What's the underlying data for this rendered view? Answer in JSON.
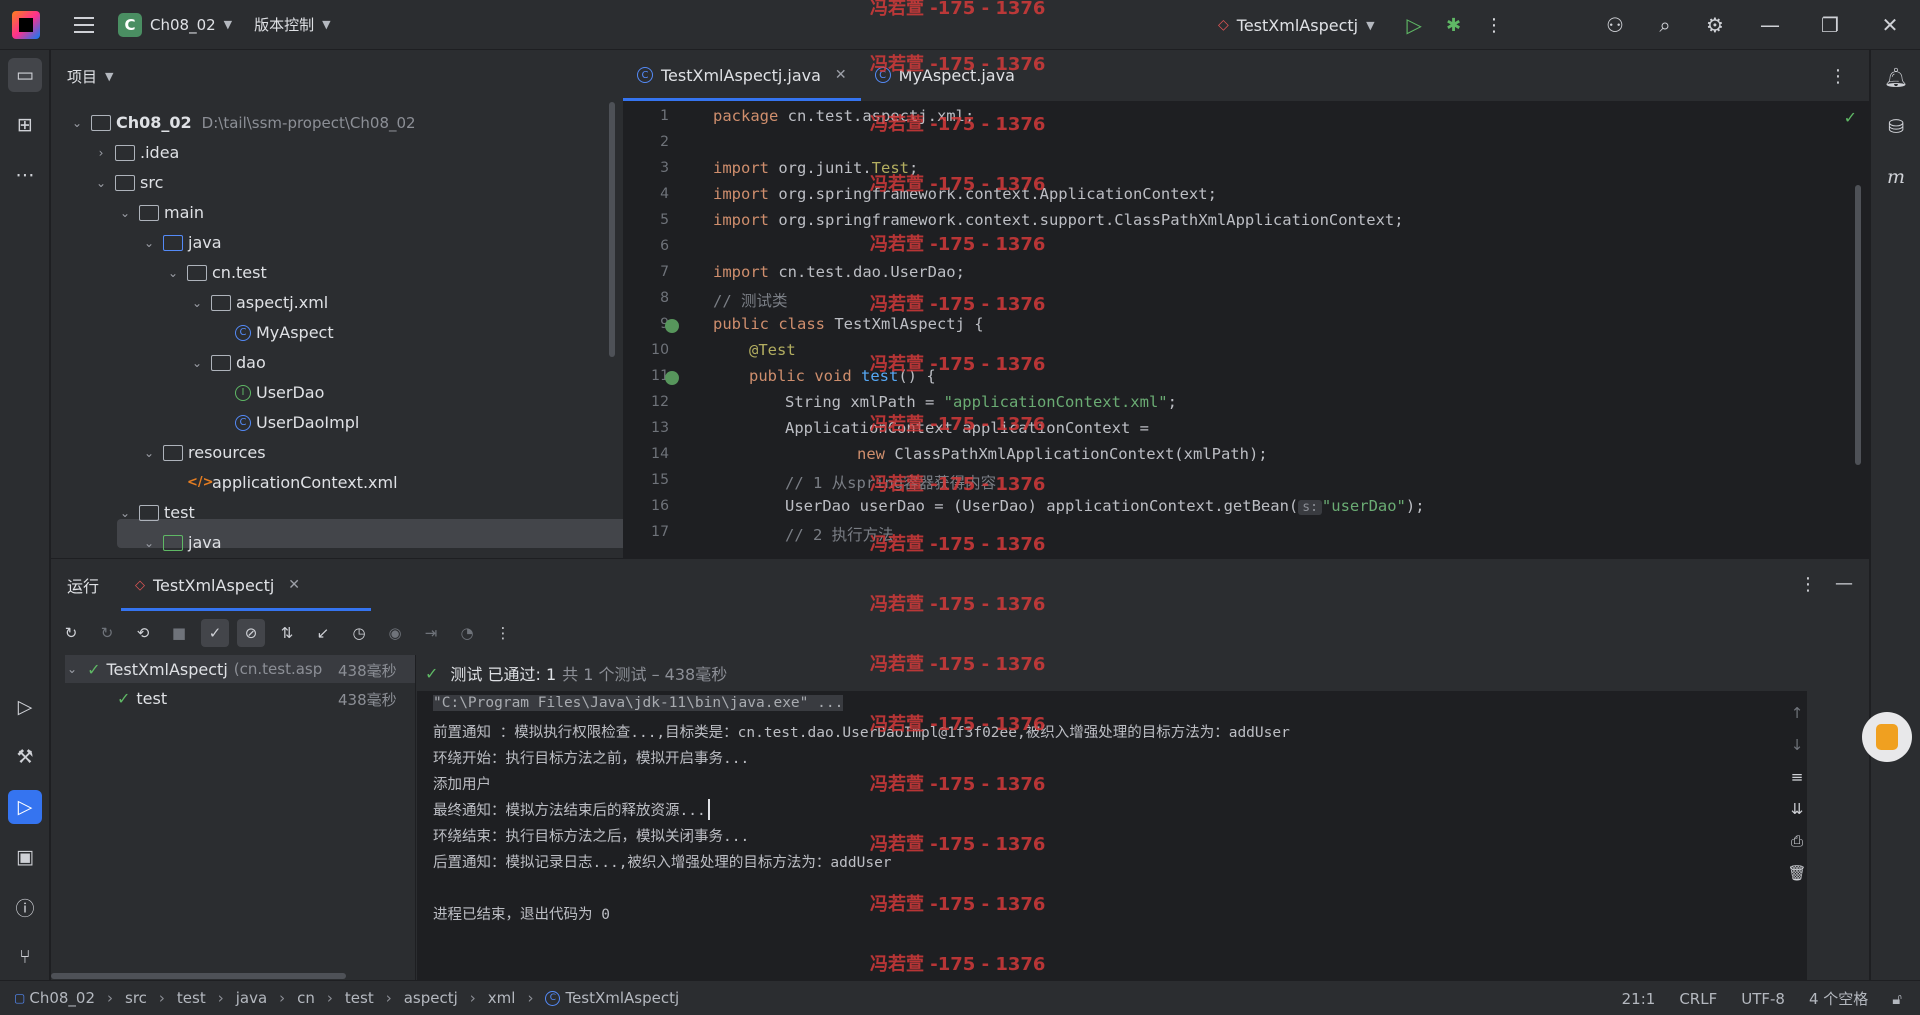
{
  "titlebar": {
    "project_badge": "C",
    "project_name": "Ch08_02",
    "vcs_label": "版本控制",
    "run_config": "TestXmlAspectj"
  },
  "project_panel": {
    "title": "项目",
    "root_name": "Ch08_02",
    "root_path": "D:\\tail\\ssm-propect\\Ch08_02",
    "items": [
      {
        "label": ".idea"
      },
      {
        "label": "src"
      },
      {
        "label": "main"
      },
      {
        "label": "java"
      },
      {
        "label": "cn.test"
      },
      {
        "label": "aspectj.xml"
      },
      {
        "label": "MyAspect"
      },
      {
        "label": "dao"
      },
      {
        "label": "UserDao"
      },
      {
        "label": "UserDaoImpl"
      },
      {
        "label": "resources"
      },
      {
        "label": "applicationContext.xml"
      },
      {
        "label": "test"
      },
      {
        "label": "java"
      }
    ]
  },
  "editor": {
    "tabs": [
      {
        "label": "TestXmlAspectj.java"
      },
      {
        "label": "MyAspect.java"
      }
    ],
    "line_numbers": [
      "1",
      "2",
      "3",
      "4",
      "5",
      "6",
      "7",
      "8",
      "9",
      "10",
      "11",
      "12",
      "13",
      "14",
      "15",
      "16",
      "17"
    ],
    "code": {
      "l1_kw": "package",
      "l1_rest": " cn.test.aspectj.xml;",
      "l3_kw": "import",
      "l3_a": " org.junit.",
      "l3_b": "Test",
      "l3_c": ";",
      "l4_kw": "import",
      "l4_rest": " org.springframework.context.ApplicationContext;",
      "l5_kw": "import",
      "l5_rest": " org.springframework.context.support.ClassPathXmlApplicationContext;",
      "l7_kw": "import",
      "l7_rest": " cn.test.dao.UserDao;",
      "l8": "// 测试类",
      "l9_kw": "public class",
      "l9_rest": " TestXmlAspectj {",
      "l10": "@Test",
      "l11_kw": "public void",
      "l11_fn": "test",
      "l11_rest": "() {",
      "l12_a": "String xmlPath = ",
      "l12_str": "\"applicationContext.xml\"",
      "l12_c": ";",
      "l13": "ApplicationContext applicationContext =",
      "l14_kw": "new",
      "l14_rest": " ClassPathXmlApplicationContext(xmlPath);",
      "l15": "// 1 从spring容器获得内容",
      "l16_a": "UserDao userDao = (UserDao) applicationContext.getBean(",
      "l16_hint": "s:",
      "l16_str": "\"userDao\"",
      "l16_c": ");",
      "l17": "// 2 执行方法"
    }
  },
  "run_panel": {
    "title": "运行",
    "tab_label": "TestXmlAspectj",
    "tree": {
      "root_label": "TestXmlAspectj",
      "root_pkg": "(cn.test.asp",
      "root_time": "438毫秒",
      "child_label": "test",
      "child_time": "438毫秒"
    },
    "status": {
      "passed": "测试 已通过: 1",
      "detail": "共 1 个测试 – 438毫秒"
    },
    "console": [
      "\"C:\\Program Files\\Java\\jdk-11\\bin\\java.exe\" ...",
      "前置通知 ：模拟执行权限检查...,目标类是：cn.test.dao.UserDaoImpl@1f3f02ee,被织入增强处理的目标方法为：addUser",
      "环绕开始：执行目标方法之前，模拟开启事务...",
      "添加用户",
      "最终通知：模拟方法结束后的释放资源...",
      "环绕结束：执行目标方法之后，模拟关闭事务...",
      "后置通知：模拟记录日志...,被织入增强处理的目标方法为：addUser",
      "",
      "进程已结束，退出代码为 0"
    ]
  },
  "statusbar": {
    "breadcrumbs": [
      "Ch08_02",
      "src",
      "test",
      "java",
      "cn",
      "test",
      "aspectj",
      "xml",
      "TestXmlAspectj"
    ],
    "position": "21:1",
    "line_sep": "CRLF",
    "encoding": "UTF-8",
    "indent": "4 个空格"
  },
  "watermark": "冯若萱 -175 - 1376",
  "colors": {
    "accent": "#3574f0",
    "success": "#5fb865",
    "background": "#1e1f22",
    "panel": "#2b2d30"
  }
}
